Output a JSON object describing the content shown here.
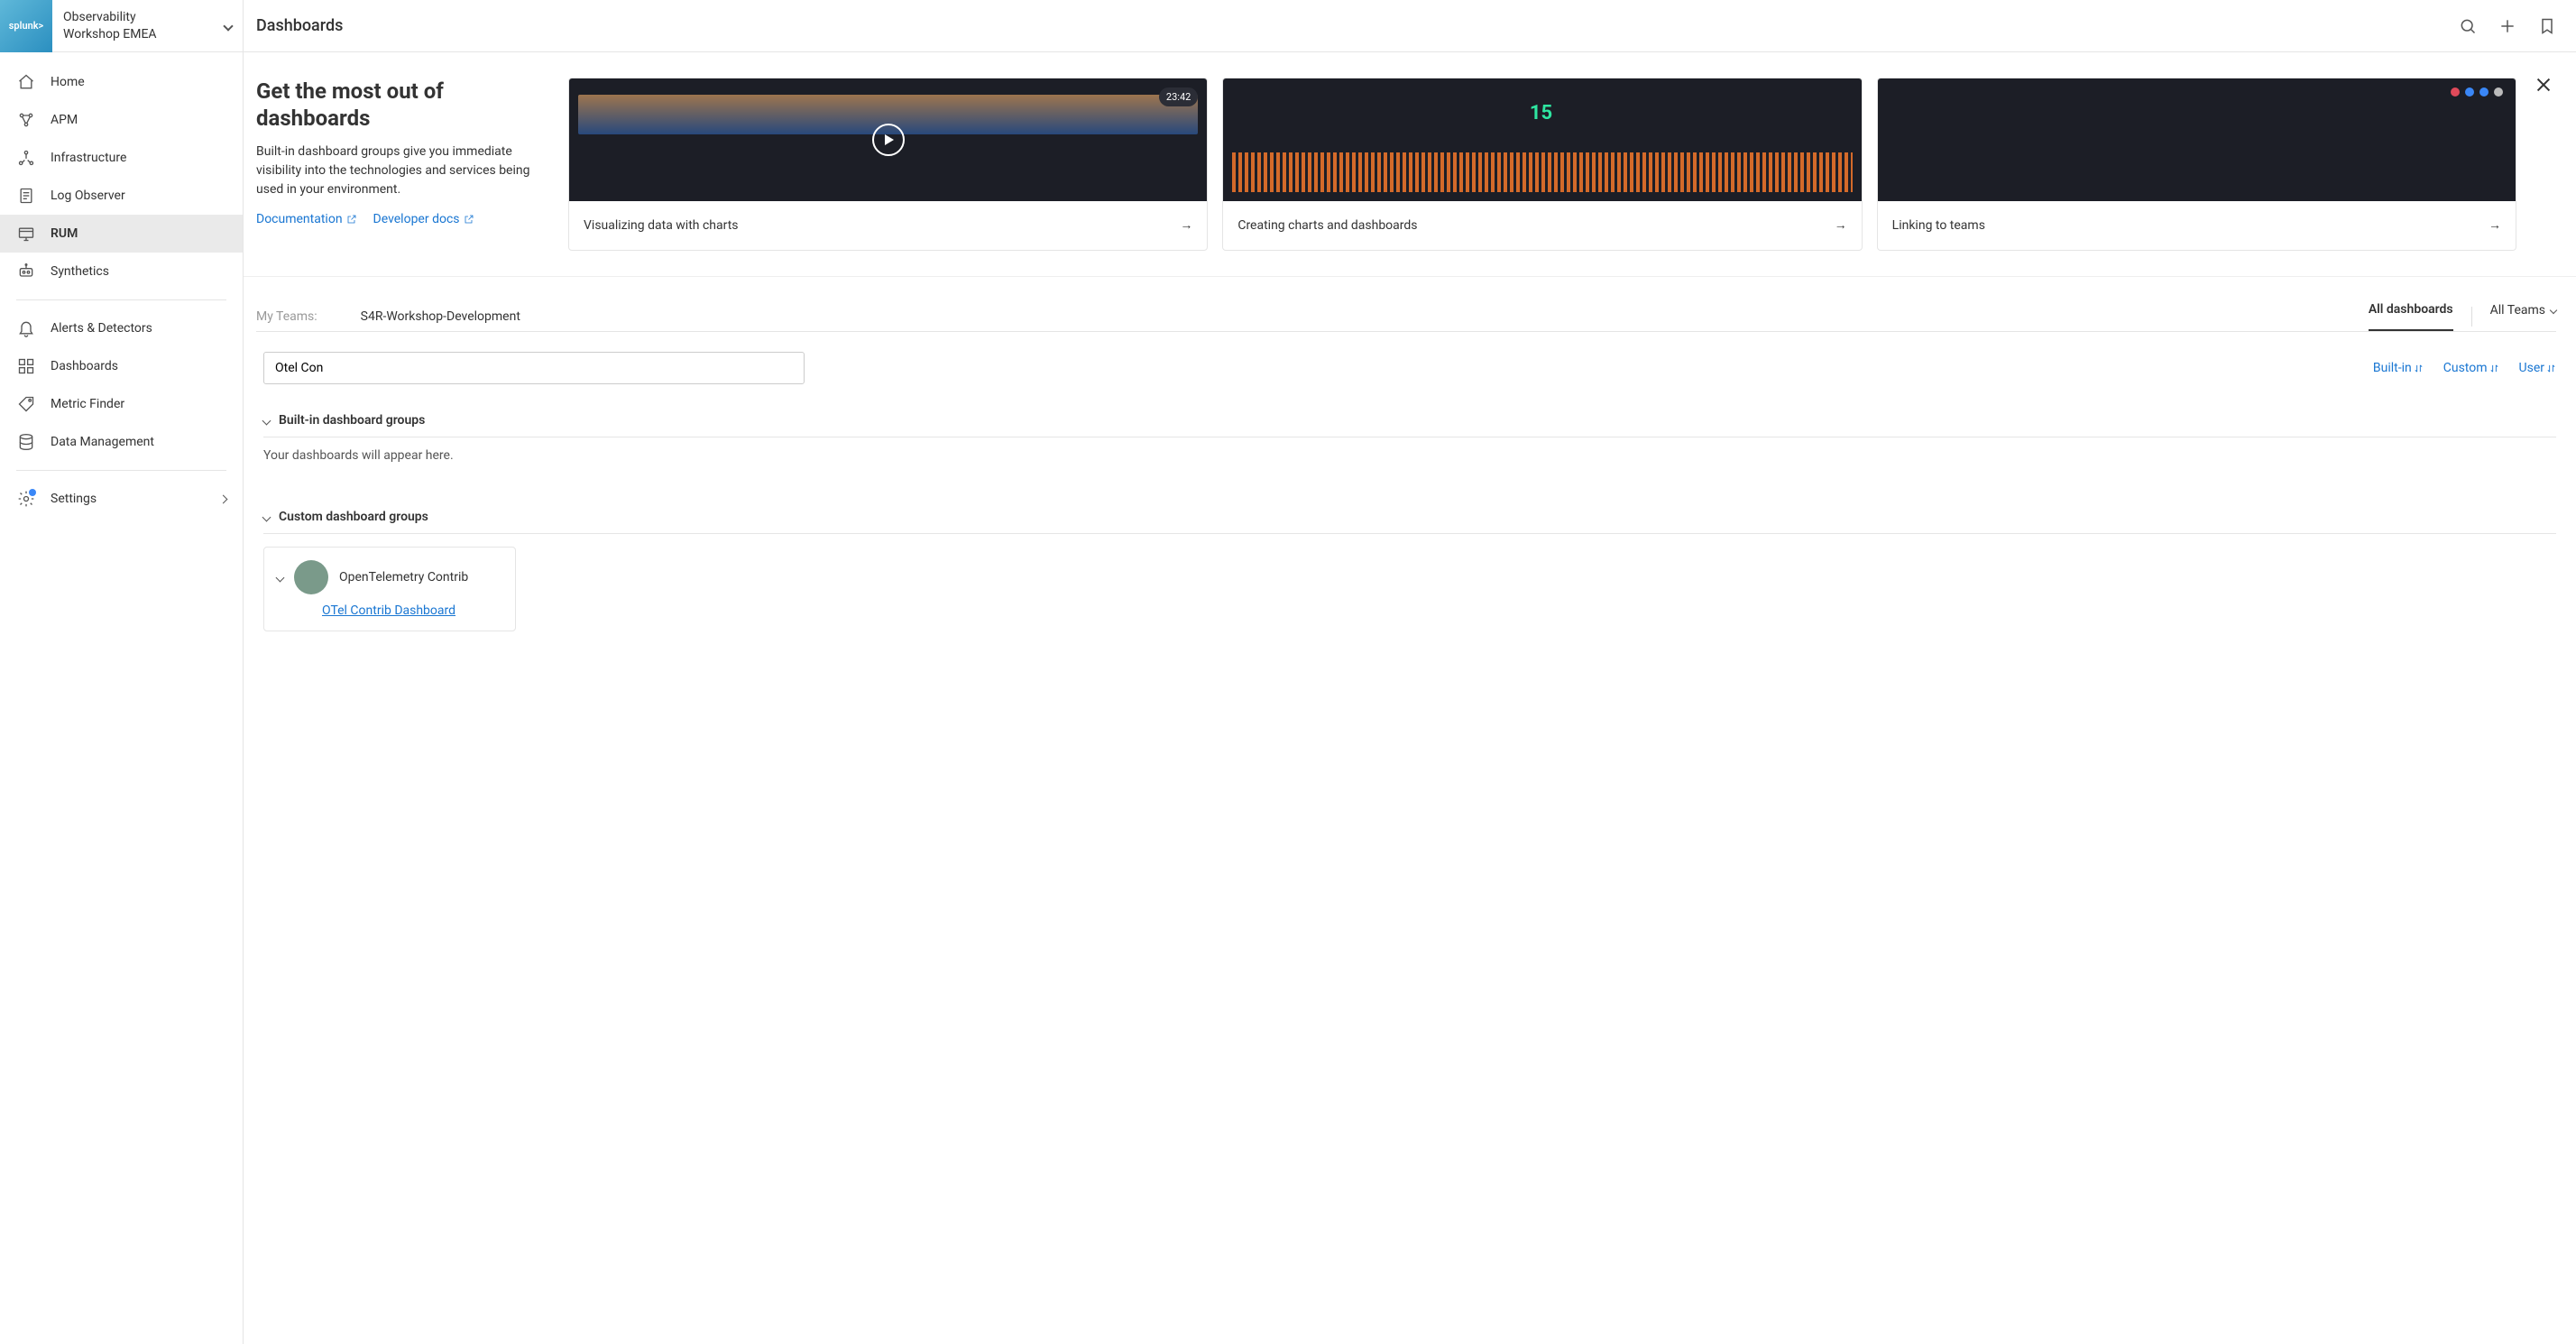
{
  "brand": "splunk>",
  "org": {
    "line1": "Observability",
    "line2": "Workshop EMEA"
  },
  "page_title": "Dashboards",
  "nav": {
    "home": "Home",
    "apm": "APM",
    "infrastructure": "Infrastructure",
    "log_observer": "Log Observer",
    "rum": "RUM",
    "synthetics": "Synthetics",
    "alerts": "Alerts & Detectors",
    "dashboards": "Dashboards",
    "metric_finder": "Metric Finder",
    "data_management": "Data Management",
    "settings": "Settings"
  },
  "promo": {
    "heading": "Get the most out of dashboards",
    "body": "Built-in dashboard groups give you immediate visibility into the technologies and services being used in your environment.",
    "doc_link": "Documentation",
    "dev_link": "Developer docs",
    "cards": {
      "c1": {
        "title": "Visualizing data with charts",
        "duration": "23:42"
      },
      "c2": {
        "title": "Creating charts and dashboards"
      },
      "c3": {
        "title": "Linking to teams"
      }
    }
  },
  "teams": {
    "label": "My Teams:",
    "name": "S4R-Workshop-Development",
    "tab_all": "All dashboards",
    "tab_teams": "All Teams"
  },
  "search": {
    "value": "Otel Con"
  },
  "filters": {
    "builtin": "Built-in",
    "custom": "Custom",
    "user": "User"
  },
  "sections": {
    "builtin": {
      "title": "Built-in dashboard groups",
      "empty": "Your dashboards will appear here."
    },
    "custom": {
      "title": "Custom dashboard groups"
    }
  },
  "group": {
    "name": "OpenTelemetry Contrib",
    "dashboard": "OTel Contrib Dashboard"
  },
  "thumb2_number": "15"
}
